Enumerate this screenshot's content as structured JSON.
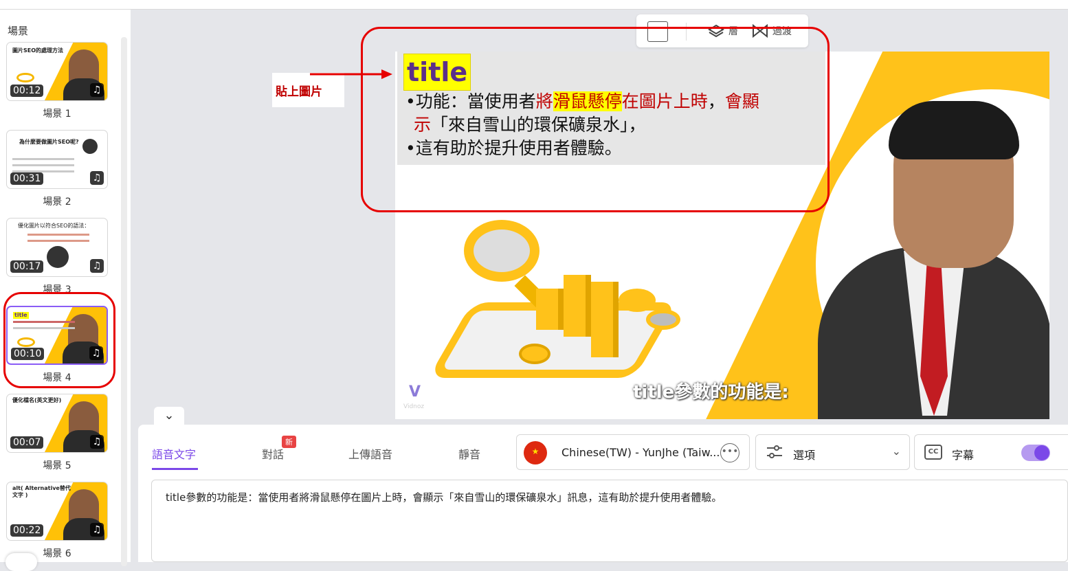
{
  "sidebar": {
    "title": "場景",
    "scenes": [
      {
        "label": "場景 1",
        "duration": "00:12",
        "thumb_title": "圖片SEO的處理方法"
      },
      {
        "label": "場景 2",
        "duration": "00:31",
        "thumb_title": "為什麼要做圖片SEO呢?"
      },
      {
        "label": "場景 3",
        "duration": "00:17",
        "thumb_title": "優化圖片以符合SEO的語法："
      },
      {
        "label": "場景 4",
        "duration": "00:10",
        "thumb_title": "title"
      },
      {
        "label": "場景 5",
        "duration": "00:07",
        "thumb_title": "優化檔名(英文更好)"
      },
      {
        "label": "場景 6",
        "duration": "00:22",
        "thumb_title": "alt( Alternative替代文字 )"
      }
    ]
  },
  "toolbar": {
    "layer_label": "層",
    "transition_label": "過渡"
  },
  "slide": {
    "title": "title",
    "line1_pre": "•功能：當使用者",
    "line1_red1": "將",
    "line1_hl": "滑鼠懸停",
    "line1_mid": "在圖片上時",
    "line1_comma": "，",
    "line1_red2": "會顯",
    "line2_red": "示",
    "line2_rest": "「來自雪山的環保礦泉水」，",
    "line3": "•這有助於提升使用者體驗。",
    "caption": "title參數的功能是:",
    "logo_text": "Vidnoz"
  },
  "annotation": {
    "note": "貼上圖片"
  },
  "panel": {
    "tabs": [
      "語音文字",
      "對話",
      "上傳語音",
      "靜音"
    ],
    "new_badge": "新",
    "voice": "Chinese(TW) - YunJhe (Taiw...",
    "options_label": "選項",
    "subtitle_label": "字幕",
    "cc_label": "CC",
    "script_text": "title參數的功能是：當使用者將滑鼠懸停在圖片上時，會顯示「來自雪山的環保礦泉水」訊息，這有助於提升使用者體驗。"
  },
  "colors": {
    "accent": "#7b48e8",
    "brand_yellow": "#ffc21a",
    "annotation_red": "#e60000"
  }
}
